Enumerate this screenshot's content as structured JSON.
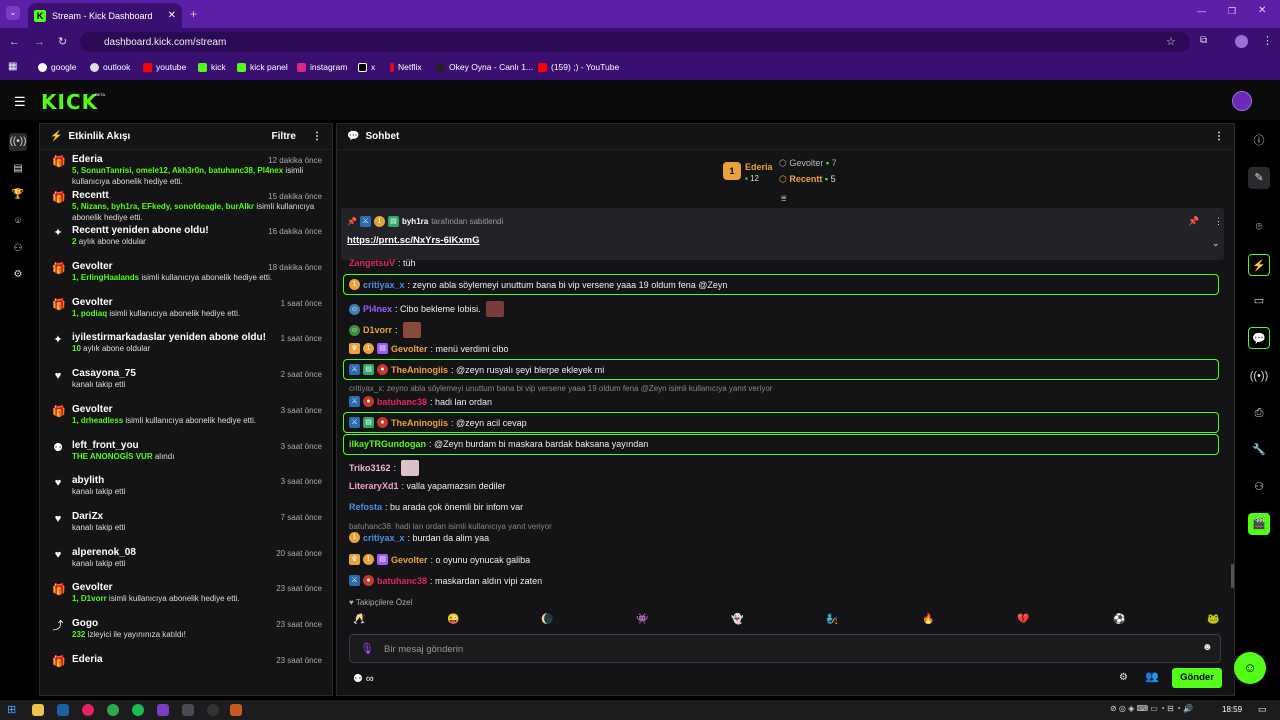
{
  "browser": {
    "tab_title": "Stream - Kick Dashboard",
    "url": "dashboard.kick.com/stream",
    "bookmarks": [
      "google",
      "outlook",
      "youtube",
      "kick",
      "kick panel",
      "instagram",
      "x",
      "Netflix",
      "Okey Oyna - Canlı 1...",
      "(159) ;) - YouTube"
    ]
  },
  "app": {
    "logo": "KICK",
    "beta": "BETA"
  },
  "feed": {
    "title": "Etkinlik Akışı",
    "filter_label": "Filtre",
    "items": [
      {
        "icon": "gift-icon",
        "name": "Ederia",
        "time": "12 dakika önce",
        "highlight": "5, SonunTanrisi, omele12, Akh3r0n, batuhanc38, Pl4nex",
        "detail": "isimli kullanıcıya abonelik hediye etti."
      },
      {
        "icon": "gift-icon",
        "name": "Recentt",
        "time": "15 dakika önce",
        "highlight": "5, Nizans, byh1ra, EFkedy, sonofdeagle, burAlkr",
        "detail": "isimli kullanıcıya abonelik hediye etti."
      },
      {
        "icon": "sparkle-icon",
        "name": "Recentt yeniden abone oldu!",
        "time": "16 dakika önce",
        "highlight": "2",
        "detail": "aylık abone oldular"
      },
      {
        "icon": "gift-icon",
        "name": "Gevolter",
        "time": "18 dakika önce",
        "highlight": "1, ErlingHaalands",
        "detail": "isimli kullanıcıya abonelik hediye etti."
      },
      {
        "icon": "gift-icon",
        "name": "Gevolter",
        "time": "1 saat önce",
        "highlight": "1, podiaq",
        "detail": "isimli kullanıcıya abonelik hediye etti."
      },
      {
        "icon": "sparkle-icon",
        "name": "iyilestirmarkadaslar yeniden abone oldu!",
        "time": "1 saat önce",
        "highlight": "10",
        "detail": "aylık abone oldular"
      },
      {
        "icon": "heart-icon",
        "name": "Casayona_75",
        "time": "2 saat önce",
        "highlight": "",
        "detail": "kanalı takip etti"
      },
      {
        "icon": "gift-icon",
        "name": "Gevolter",
        "time": "3 saat önce",
        "highlight": "1, drheadless",
        "detail": "isimli kullanıcıya abonelik hediye etti."
      },
      {
        "icon": "redeem-icon",
        "name": "left_front_you",
        "time": "3 saat önce",
        "highlight": "THE ANONOGİS VUR",
        "detail": "alındı"
      },
      {
        "icon": "heart-icon",
        "name": "abylith",
        "time": "3 saat önce",
        "highlight": "",
        "detail": "kanalı takip etti"
      },
      {
        "icon": "heart-icon",
        "name": "DariZx",
        "time": "7 saat önce",
        "highlight": "",
        "detail": "kanalı takip etti"
      },
      {
        "icon": "heart-icon",
        "name": "alperenok_08",
        "time": "20 saat önce",
        "highlight": "",
        "detail": "kanalı takip etti"
      },
      {
        "icon": "gift-icon",
        "name": "Gevolter",
        "time": "23 saat önce",
        "highlight": "1, D1vorr",
        "detail": "isimli kullanıcıya abonelik hediye etti."
      },
      {
        "icon": "host-icon",
        "name": "Gogo",
        "time": "23 saat önce",
        "highlight": "232",
        "detail": "izleyici ile yayınınıza katıldı!"
      },
      {
        "icon": "gift-icon",
        "name": "Ederia",
        "time": "23 saat önce",
        "highlight": "",
        "detail": ""
      }
    ]
  },
  "chat": {
    "title": "Sohbet",
    "leaderboard": {
      "first": {
        "rank": "1",
        "name": "Ederia",
        "count": "12"
      },
      "second": {
        "name": "Gevolter",
        "count": "7"
      },
      "third": {
        "name": "Recentt",
        "count": "5"
      }
    },
    "pinned": {
      "by": "byh1ra",
      "by_suffix": "tarafından sabitlendi",
      "link": "https://prnt.sc/NxYrs-6lKxmG"
    },
    "messages": [
      {
        "user": "ZangetsuV",
        "cls": "u-red",
        "text": ": tüh"
      },
      {
        "user": "critiyax_x",
        "cls": "u-blue",
        "text": ": zeyno abla söylemeyi unuttum bana bi vip versene yaaa 19 oldum fena @Zeyn"
      },
      {
        "user": "Pl4nex",
        "cls": "u-purple",
        "text": ": Cibo bekleme lobisi."
      },
      {
        "user": "D1vorr",
        "cls": "u-orange",
        "text": ":"
      },
      {
        "user": "Gevolter",
        "cls": "u-orange",
        "text": ": menü verdimi cibo"
      },
      {
        "user": "TheAninogiis",
        "cls": "u-orange",
        "text": ": @zeyn rusyalı şeyi blerpe ekleyek mi"
      },
      {
        "user": "batuhanc38",
        "cls": "u-red",
        "text": ": hadi lan ordan"
      },
      {
        "user": "TheAninogiis",
        "cls": "u-orange",
        "text": ": @zeyn acil cevap"
      },
      {
        "user": "ilkayTRGundogan",
        "cls": "u-green",
        "text": ": @Zeyn burdam bi maskara bardak baksana yayından"
      },
      {
        "user": "Triko3162",
        "cls": "u-lpink",
        "text": ":"
      },
      {
        "user": "LiteraryXd1",
        "cls": "u-pink",
        "text": ": valla yapamazsın dediler"
      },
      {
        "user": "Refosta",
        "cls": "u-blue",
        "text": ": bu arada çok önemli bir infom var"
      },
      {
        "user": "critiyax_x",
        "cls": "u-blue",
        "text": ": burdan da alim yaa"
      },
      {
        "user": "Gevolter",
        "cls": "u-orange",
        "text": ": o oyunu oynucak galiba"
      },
      {
        "user": "batuhanc38",
        "cls": "u-red",
        "text": ": maskardan aldın vipi zaten"
      }
    ],
    "reply1": "critiyax_x: zeyno abla söylemeyi unuttum bana bi vip versene yaaa 19 oldum fena @Zeyn isimli kullanıcıya yanıt veriyor",
    "reply2": "batuhanc38: hadi lan ordan isimli kullanıcıya yanıt veriyor",
    "emote_section": "Takipçilere Özel",
    "input_placeholder": "Bir mesaj gönderin",
    "send_label": "Gönder"
  },
  "taskbar": {
    "time": "18:59"
  },
  "colors": {
    "accent": "#53fc18",
    "brand_purple": "#5c1fa8",
    "panel": "#141416"
  }
}
